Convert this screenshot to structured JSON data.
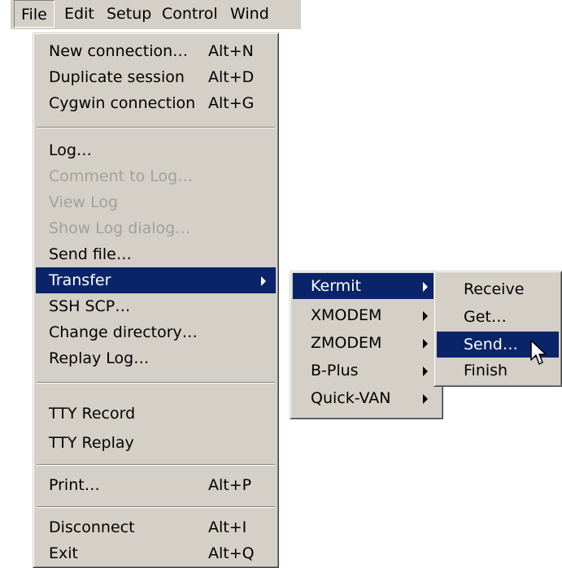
{
  "menubar": {
    "items": [
      "File",
      "Edit",
      "Setup",
      "Control",
      "Wind"
    ]
  },
  "file_menu": {
    "new_connection": {
      "label": "New connection…",
      "shortcut": "Alt+N"
    },
    "duplicate_session": {
      "label": "Duplicate session",
      "shortcut": "Alt+D"
    },
    "cygwin_connection": {
      "label": "Cygwin connection",
      "shortcut": "Alt+G"
    },
    "log": {
      "label": "Log…"
    },
    "comment_to_log": {
      "label": "Comment to Log…"
    },
    "view_log": {
      "label": "View Log"
    },
    "show_log_dialog": {
      "label": "Show Log dialog…"
    },
    "send_file": {
      "label": "Send file…"
    },
    "transfer": {
      "label": "Transfer"
    },
    "ssh_scp": {
      "label": "SSH SCP…"
    },
    "change_directory": {
      "label": "Change directory…"
    },
    "replay_log": {
      "label": "Replay Log…"
    },
    "tty_record": {
      "label": "TTY Record"
    },
    "tty_replay": {
      "label": "TTY Replay"
    },
    "print": {
      "label": "Print…",
      "shortcut": "Alt+P"
    },
    "disconnect": {
      "label": "Disconnect",
      "shortcut": "Alt+I"
    },
    "exit": {
      "label": "Exit",
      "shortcut": "Alt+Q"
    }
  },
  "transfer_menu": {
    "items": [
      "Kermit",
      "XMODEM",
      "ZMODEM",
      "B-Plus",
      "Quick-VAN"
    ]
  },
  "kermit_menu": {
    "items": [
      "Receive",
      "Get…",
      "Send…",
      "Finish"
    ]
  },
  "colors": {
    "menu_bg": "#d4d0c8",
    "highlight": "#0a246a",
    "disabled_text": "#a0a0a0"
  }
}
